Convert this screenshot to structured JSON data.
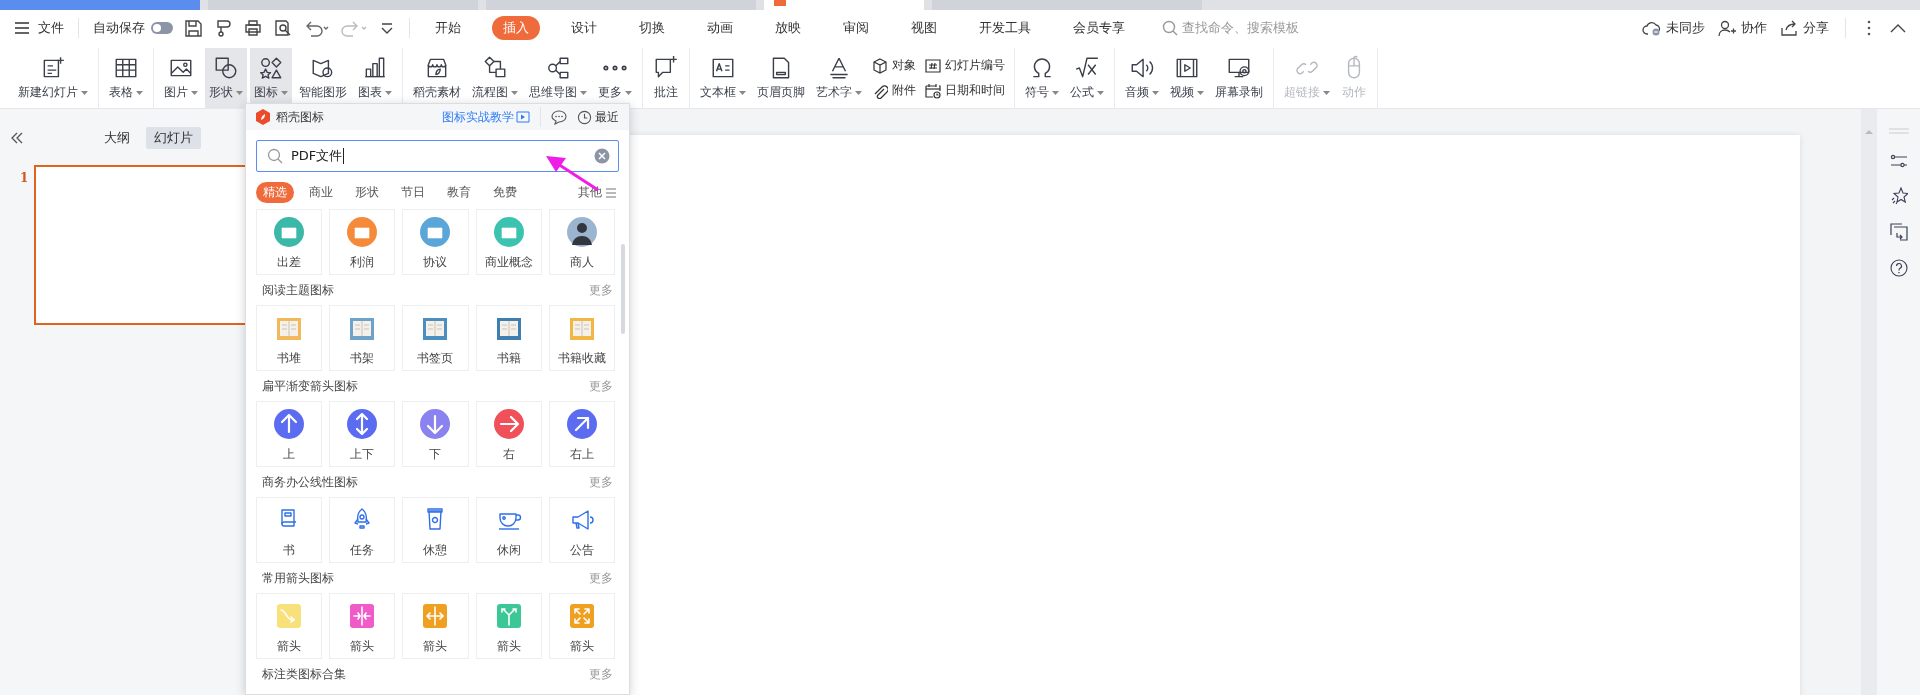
{
  "menubar": {
    "file": "文件",
    "autosave": {
      "label": "自动保存",
      "on": false
    },
    "tabs": [
      {
        "label": "开始",
        "selected": false
      },
      {
        "label": "插入",
        "selected": true
      },
      {
        "label": "设计",
        "selected": false
      },
      {
        "label": "切换",
        "selected": false
      },
      {
        "label": "动画",
        "selected": false
      },
      {
        "label": "放映",
        "selected": false
      },
      {
        "label": "审阅",
        "selected": false
      },
      {
        "label": "视图",
        "selected": false
      },
      {
        "label": "开发工具",
        "selected": false
      },
      {
        "label": "会员专享",
        "selected": false
      }
    ],
    "search": {
      "placeholder": "查找命令、搜索模板"
    },
    "actions": [
      "未同步",
      "协作",
      "分享"
    ]
  },
  "ribbon": {
    "groups": [
      {
        "items": [
          {
            "kind": "large",
            "label": "新建幻灯片",
            "menu": true,
            "highlighted": false,
            "disabled": false
          }
        ]
      },
      {
        "items": [
          {
            "kind": "large",
            "label": "表格",
            "menu": true,
            "highlighted": false,
            "disabled": false
          }
        ]
      },
      {
        "items": [
          {
            "kind": "large",
            "label": "图片",
            "menu": true,
            "highlighted": false,
            "disabled": false
          },
          {
            "kind": "large",
            "label": "形状",
            "menu": true,
            "highlighted": true,
            "disabled": false
          },
          {
            "kind": "large",
            "label": "图标",
            "menu": true,
            "highlighted": true,
            "disabled": false
          },
          {
            "kind": "large",
            "label": "智能图形",
            "menu": false,
            "highlighted": false,
            "disabled": false
          },
          {
            "kind": "large",
            "label": "图表",
            "menu": true,
            "highlighted": false,
            "disabled": false
          }
        ]
      },
      {
        "items": [
          {
            "kind": "large",
            "label": "稻壳素材",
            "menu": false,
            "highlighted": false,
            "disabled": false
          },
          {
            "kind": "large",
            "label": "流程图",
            "menu": true,
            "highlighted": false,
            "disabled": false
          },
          {
            "kind": "large",
            "label": "思维导图",
            "menu": true,
            "highlighted": false,
            "disabled": false
          },
          {
            "kind": "large",
            "label": "更多",
            "menu": true,
            "highlighted": false,
            "disabled": false
          }
        ]
      },
      {
        "items": [
          {
            "kind": "large",
            "label": "批注",
            "menu": false,
            "highlighted": false,
            "disabled": false
          }
        ]
      },
      {
        "items": [
          {
            "kind": "large",
            "label": "文本框",
            "menu": true,
            "highlighted": false,
            "disabled": false
          },
          {
            "kind": "large",
            "label": "页眉页脚",
            "menu": false,
            "highlighted": false,
            "disabled": false
          },
          {
            "kind": "large",
            "label": "艺术字",
            "menu": true,
            "highlighted": false,
            "disabled": false
          },
          {
            "kind": "pair",
            "items": [
              {
                "label": "对象"
              },
              {
                "label": "附件"
              }
            ]
          },
          {
            "kind": "pair",
            "items": [
              {
                "label": "幻灯片编号"
              },
              {
                "label": "日期和时间"
              }
            ]
          }
        ]
      },
      {
        "items": [
          {
            "kind": "large",
            "label": "符号",
            "menu": true,
            "highlighted": false,
            "disabled": false
          },
          {
            "kind": "large",
            "label": "公式",
            "menu": true,
            "highlighted": false,
            "disabled": false
          }
        ]
      },
      {
        "items": [
          {
            "kind": "large",
            "label": "音频",
            "menu": true,
            "highlighted": false,
            "disabled": false
          },
          {
            "kind": "large",
            "label": "视频",
            "menu": true,
            "highlighted": false,
            "disabled": false
          },
          {
            "kind": "large",
            "label": "屏幕录制",
            "menu": false,
            "highlighted": false,
            "disabled": false
          }
        ]
      },
      {
        "items": [
          {
            "kind": "large",
            "label": "超链接",
            "menu": true,
            "highlighted": false,
            "disabled": true
          },
          {
            "kind": "large",
            "label": "动作",
            "menu": false,
            "highlighted": false,
            "disabled": true
          }
        ]
      }
    ]
  },
  "slide_pane": {
    "tabs": [
      {
        "label": "大纲",
        "selected": false
      },
      {
        "label": "幻灯片",
        "selected": true
      }
    ],
    "slides": [
      {
        "number": "1",
        "selected": true
      }
    ]
  },
  "icon_panel": {
    "title": "稻壳图标",
    "tutorial_link": "图标实战教学",
    "recent": "最近",
    "search": {
      "value": "PDF文件"
    },
    "categories": [
      {
        "label": "精选",
        "selected": true
      },
      {
        "label": "商业",
        "selected": false
      },
      {
        "label": "形状",
        "selected": false
      },
      {
        "label": "节日",
        "selected": false
      },
      {
        "label": "教育",
        "selected": false
      },
      {
        "label": "免费",
        "selected": false
      }
    ],
    "other": "其他",
    "sections": [
      {
        "kind": "round",
        "items": [
          {
            "label": "出差",
            "color": "#3cb8a8"
          },
          {
            "label": "利润",
            "color": "#f58a3a"
          },
          {
            "label": "协议",
            "color": "#5aa6d8"
          },
          {
            "label": "商业概念",
            "color": "#3cc3b0"
          },
          {
            "label": "商人",
            "color": "#9bb4d0"
          }
        ]
      },
      {
        "title": "阅读主题图标",
        "more": "更多",
        "kind": "book",
        "items": [
          {
            "label": "书堆",
            "color": "#f3b85c"
          },
          {
            "label": "书架",
            "color": "#6ea2c8"
          },
          {
            "label": "书签页",
            "color": "#4d8ec0"
          },
          {
            "label": "书籍",
            "color": "#3f7fb0"
          },
          {
            "label": "书籍收藏",
            "color": "#f2b644"
          }
        ]
      },
      {
        "title": "扁平渐变箭头图标",
        "more": "更多",
        "kind": "arrow",
        "items": [
          {
            "label": "上",
            "color": "#5b6cf0"
          },
          {
            "label": "上下",
            "color": "#5b6cf0"
          },
          {
            "label": "下",
            "color": "#8a82ee"
          },
          {
            "label": "右",
            "color": "#f0505a"
          },
          {
            "label": "右上",
            "color": "#5b6cf0"
          }
        ]
      },
      {
        "title": "商务办公线性图标",
        "more": "更多",
        "kind": "line",
        "items": [
          {
            "label": "书"
          },
          {
            "label": "任务"
          },
          {
            "label": "休憩"
          },
          {
            "label": "休闲"
          },
          {
            "label": "公告"
          }
        ]
      },
      {
        "title": "常用箭头图标",
        "more": "更多",
        "kind": "tile",
        "items": [
          {
            "label": "箭头",
            "color": "#f8e07a"
          },
          {
            "label": "箭头",
            "color": "#f05bc8"
          },
          {
            "label": "箭头",
            "color": "#f0a020"
          },
          {
            "label": "箭头",
            "color": "#3cc796"
          },
          {
            "label": "箭头",
            "color": "#f0a020"
          }
        ]
      },
      {
        "title": "标注类图标合集",
        "more": "更多"
      }
    ]
  }
}
